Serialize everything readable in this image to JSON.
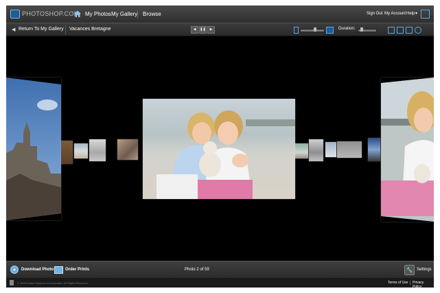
{
  "header": {
    "logo_text": "PHOTOSHOP.COM",
    "nav": [
      "My Photos",
      "My Gallery",
      "Browse"
    ],
    "right_links": [
      "Sign Out",
      "My Account",
      "Help"
    ]
  },
  "subbar": {
    "return_label": "Return To My Gallery",
    "album_title": "Vacances Bretagne",
    "duration_label": "Duration:"
  },
  "bottom": {
    "download_label": "Download Photo",
    "order_label": "Order Prints",
    "counter": "Photo 2 of 59",
    "settings_label": "Settings"
  },
  "footer": {
    "copyright": "© 2008 Adobe Systems Incorporated. All Rights Reserved.",
    "terms": "Terms of Use",
    "privacy": "Privacy Policy"
  },
  "icons": {
    "home": "home-icon",
    "back": "back-arrow-icon",
    "prev": "previous-icon",
    "pause": "pause-icon",
    "next": "next-icon",
    "settings": "wrench-icon"
  },
  "colors": {
    "accent": "#5aa9e6",
    "background": "#000000",
    "bar": "#333333"
  }
}
